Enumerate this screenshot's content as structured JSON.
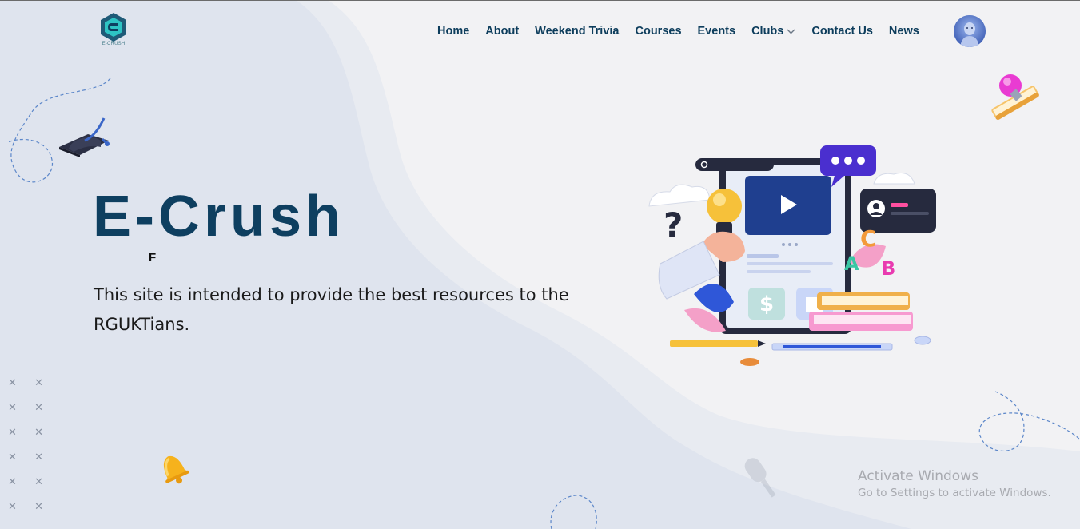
{
  "logo": {
    "text": "E-CRUSH"
  },
  "nav": {
    "items": [
      {
        "label": "Home"
      },
      {
        "label": "About"
      },
      {
        "label": "Weekend Trivia"
      },
      {
        "label": "Courses"
      },
      {
        "label": "Events"
      },
      {
        "label": "Clubs",
        "has_dropdown": true
      },
      {
        "label": "Contact Us"
      },
      {
        "label": "News"
      }
    ]
  },
  "hero": {
    "title": "E-Crush",
    "typing_text": "F",
    "description": "This site is intended to provide the best resources to the RGUKTians."
  },
  "watermark": {
    "line1": "Activate Windows",
    "line2": "Go to Settings to activate Windows."
  },
  "colors": {
    "brand_navy": "#0e3f60",
    "nav_text": "#0d3d5c",
    "blob_bg": "#dfe4ee",
    "page_bg": "#f2f2f4"
  },
  "icons": [
    "logo-icon",
    "chevron-down-icon",
    "graduation-cap-icon",
    "bell-icon",
    "lightbulb-book-icon",
    "education-illustration"
  ]
}
